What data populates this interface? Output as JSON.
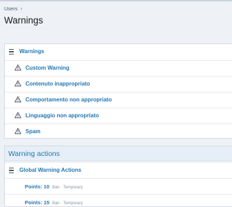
{
  "breadcrumb": {
    "item": "Users"
  },
  "page": {
    "title": "Warnings"
  },
  "warnings_list": {
    "header": "Warnings",
    "items": [
      {
        "label": "Custom Warning"
      },
      {
        "label": "Contenuto inappropriato"
      },
      {
        "label": "Comportamento non appropriato"
      },
      {
        "label": "Linguaggio non appropriato"
      },
      {
        "label": "Spam"
      }
    ]
  },
  "warning_actions": {
    "title": "Warning actions",
    "group_label": "Global Warning Actions",
    "actions": [
      {
        "points_label": "Points:",
        "points": "10",
        "ban": "Ban",
        "sep": "·",
        "duration": "Temporary"
      },
      {
        "points_label": "Points:",
        "points": "15",
        "ban": "Ban",
        "sep": "·",
        "duration": "Temporary"
      }
    ]
  },
  "colors": {
    "link": "#2577b1",
    "page_bg": "#eef1f5",
    "section_header_bg": "#e6eef7"
  }
}
